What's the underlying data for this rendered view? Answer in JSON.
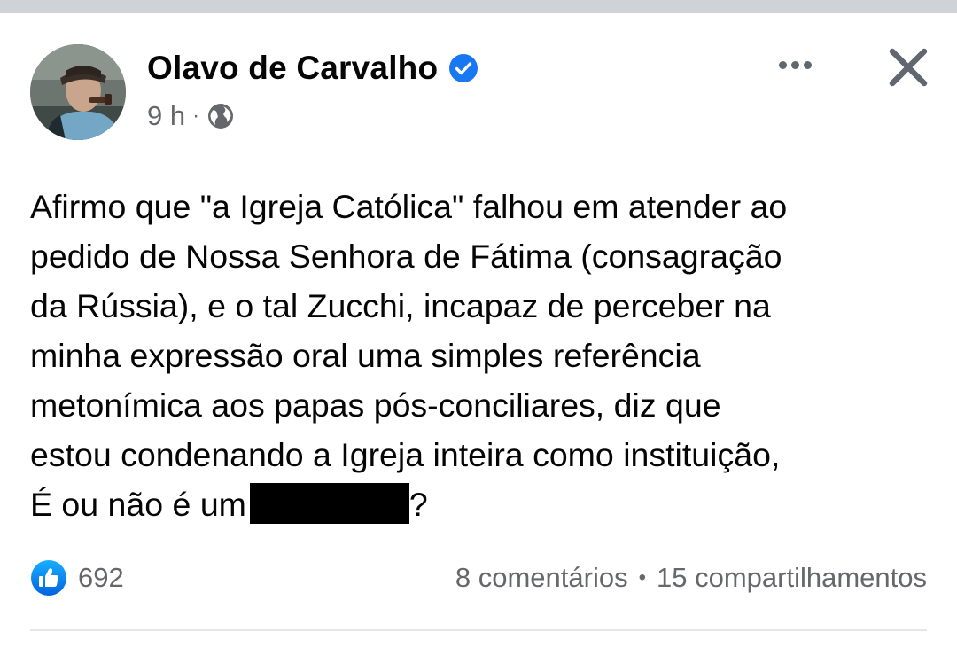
{
  "post": {
    "author": {
      "name": "Olavo de Carvalho",
      "verified": true,
      "avatar_icon": "avatar-photo"
    },
    "meta": {
      "time": "9 h",
      "separator": "·",
      "audience_icon": "globe-icon"
    },
    "actions": {
      "more_icon": "more-options-icon",
      "close_icon": "close-icon"
    },
    "text_lines": [
      "Afirmo que \"a Igreja Católica\" falhou em atender ao",
      "pedido de Nossa Senhora de Fátima (consagração",
      "da Rússia), e o tal Zucchi, incapaz de perceber na",
      "minha expressão oral uma simples referência",
      "metonímica aos papas pós-conciliares, diz que",
      "estou condenando a Igreja inteira como instituição,"
    ],
    "last_line": {
      "before_redaction": "É ou não é um",
      "after_redaction": "?"
    },
    "stats": {
      "reaction_icon": "like-icon",
      "reaction_count": "692",
      "comments": "8 comentários",
      "separator": "•",
      "shares": "15 compartilhamentos"
    }
  },
  "colors": {
    "primary_text": "#050505",
    "secondary_text": "#65676b",
    "accent_blue": "#1877f2",
    "divider": "#e4e6eb",
    "top_strip": "#cfd2d6"
  }
}
